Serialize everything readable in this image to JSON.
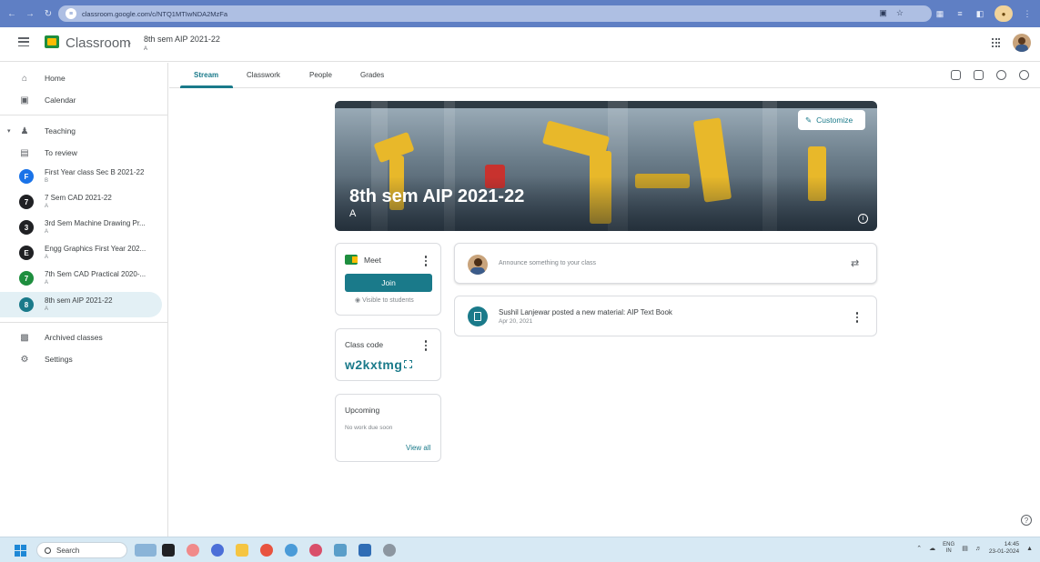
{
  "browser": {
    "url": "classroom.google.com/c/NTQ1MTIwNDA2MzFa"
  },
  "header": {
    "app_name": "Classroom",
    "class_title": "8th sem AIP 2021-22",
    "class_section": "A"
  },
  "sidebar": {
    "home": "Home",
    "calendar": "Calendar",
    "teaching": "Teaching",
    "to_review": "To review",
    "classes": [
      {
        "initial": "F",
        "name": "First Year class Sec B 2021-22",
        "section": "B",
        "color": "#1a73e8"
      },
      {
        "initial": "7",
        "name": "7 Sem CAD 2021-22",
        "section": "A",
        "color": "#202124"
      },
      {
        "initial": "3",
        "name": "3rd Sem Machine Drawing Pr...",
        "section": "A",
        "color": "#202124"
      },
      {
        "initial": "E",
        "name": "Engg Graphics First Year 202...",
        "section": "A",
        "color": "#202124"
      },
      {
        "initial": "7",
        "name": "7th Sem CAD Practical 2020-...",
        "section": "A",
        "color": "#1e8e3e"
      },
      {
        "initial": "8",
        "name": "8th sem AIP 2021-22",
        "section": "A",
        "color": "#1a7a8a"
      }
    ],
    "archived": "Archived classes",
    "settings": "Settings"
  },
  "tabs": [
    "Stream",
    "Classwork",
    "People",
    "Grades"
  ],
  "banner": {
    "title": "8th sem AIP 2021-22",
    "section": "A",
    "customize": "Customize"
  },
  "meet": {
    "label": "Meet",
    "join": "Join",
    "visibility": "Visible to students"
  },
  "class_code": {
    "label": "Class code",
    "code": "w2kxtmg"
  },
  "upcoming": {
    "label": "Upcoming",
    "empty": "No work due soon",
    "view_all": "View all"
  },
  "stream": {
    "announce_placeholder": "Announce something to your class",
    "post_title": "Sushil Lanjewar posted a new material: AIP Text Book",
    "post_date": "Apr 20, 2021"
  },
  "taskbar": {
    "search": "Search",
    "lang_top": "ENG",
    "lang_bottom": "IN",
    "time": "14:45",
    "date": "23-01-2024"
  },
  "colors": {
    "accent": "#1a7a8a",
    "browser": "#5f7fc4",
    "taskbar": "#d7e9f4"
  }
}
